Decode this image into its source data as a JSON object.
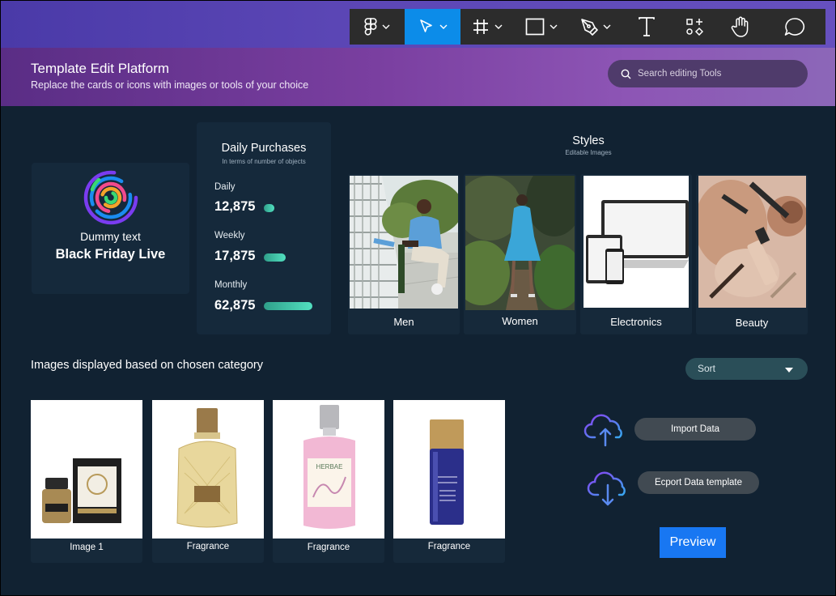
{
  "toolbar": {
    "tools": [
      {
        "name": "figma-logo",
        "has_menu": true
      },
      {
        "name": "move-tool",
        "has_menu": true,
        "active": true
      },
      {
        "name": "frame-tool",
        "has_menu": true
      },
      {
        "name": "shape-tool",
        "has_menu": true
      },
      {
        "name": "pen-tool",
        "has_menu": true
      },
      {
        "name": "text-tool",
        "has_menu": false
      },
      {
        "name": "components-tool",
        "has_menu": false
      },
      {
        "name": "hand-tool",
        "has_menu": false
      },
      {
        "name": "comment-tool",
        "has_menu": false
      }
    ],
    "active_color": "#0c8ce9"
  },
  "header": {
    "title": "Template Edit Platform",
    "subtitle": "Replace the cards or icons with images or tools of your choice",
    "search_placeholder": "Search editing Tools"
  },
  "promo": {
    "small_text": "Dummy text",
    "big_text": "Black Friday Live"
  },
  "daily_purchases": {
    "title": "Daily Purchases",
    "subtitle": "In terms of number of objects",
    "stats": [
      {
        "label": "Daily",
        "value": "12,875",
        "level": 0.22
      },
      {
        "label": "Weekly",
        "value": "17,875",
        "level": 0.45
      },
      {
        "label": "Monthly",
        "value": "62,875",
        "level": 1.0
      }
    ]
  },
  "styles": {
    "title": "Styles",
    "subtitle": "Editable Images",
    "cards": [
      {
        "label": "Men",
        "image": "man-sitting-photo"
      },
      {
        "label": "Women",
        "image": "woman-forest-photo"
      },
      {
        "label": "Electronics",
        "image": "devices-photo"
      },
      {
        "label": "Beauty",
        "image": "cosmetics-photo"
      }
    ]
  },
  "products": {
    "section_title": "Images displayed based on  chosen category",
    "sort_label": "Sort",
    "items": [
      {
        "label": "Image 1",
        "image": "fragrance-box-photo"
      },
      {
        "label": "Fragrance",
        "image": "gold-perfume-photo"
      },
      {
        "label": "Fragrance",
        "image": "pink-bottle-photo",
        "bottle_label": "HERBAE"
      },
      {
        "label": "Fragrance",
        "image": "blue-bottle-photo"
      }
    ]
  },
  "actions": {
    "import_label": "Import Data",
    "export_label": "Ecport Data template",
    "preview_label": "Preview"
  }
}
